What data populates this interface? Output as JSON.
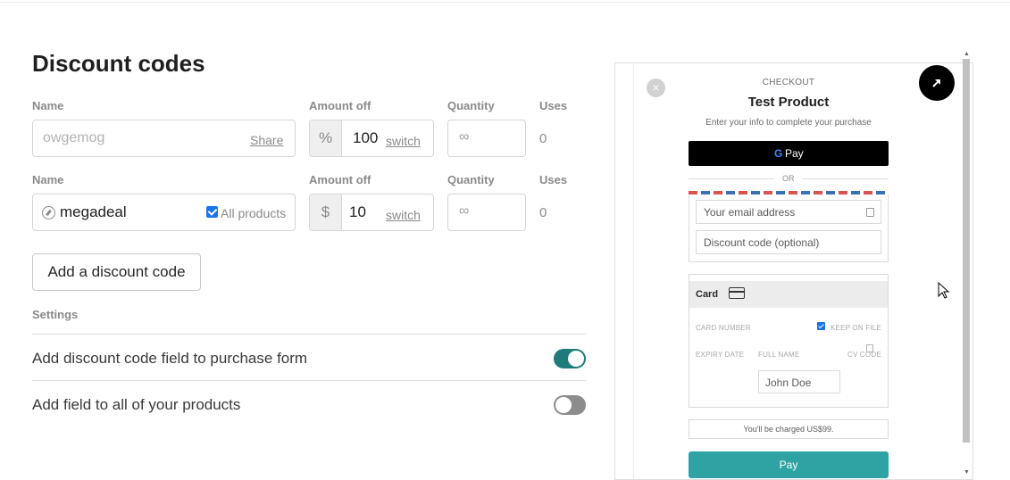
{
  "page": {
    "title": "Discount codes"
  },
  "columns": {
    "name": "Name",
    "amount_off": "Amount off",
    "quantity": "Quantity",
    "uses": "Uses"
  },
  "codes": [
    {
      "name_placeholder": "owgemog",
      "share_label": "Share",
      "unit": "%",
      "amount": "100",
      "switch_label": "switch",
      "quantity": "∞",
      "uses": "0"
    },
    {
      "name": "megadeal",
      "icon": "compass-icon",
      "all_products_label": "All products",
      "all_products_checked": true,
      "unit": "$",
      "amount": "10",
      "switch_label": "switch",
      "quantity": "∞",
      "uses": "0"
    }
  ],
  "add_button_label": "Add a discount code",
  "settings": {
    "label": "Settings",
    "items": [
      {
        "label": "Add discount code field to purchase form",
        "enabled": true
      },
      {
        "label": "Add field to all of your products",
        "enabled": false
      }
    ]
  },
  "preview": {
    "close_symbol": "×",
    "checkout_label": "CHECKOUT",
    "product_title": "Test Product",
    "subtitle": "Enter your info to complete your purchase",
    "gpay_g": "G",
    "gpay_label": "Pay",
    "or_label": "OR",
    "email_placeholder": "Your email address",
    "discount_placeholder": "Discount code (optional)",
    "card_title": "Card",
    "card_number_label": "CARD NUMBER",
    "keep_on_file_label": "KEEP ON FILE",
    "keep_on_file_checked": true,
    "expiry_label": "EXPIRY DATE",
    "full_name_label": "FULL NAME",
    "cv_label": "CV CODE",
    "name_placeholder": "John Doe",
    "charged_text": "You'll be charged US$99.",
    "pay_label": "Pay"
  },
  "colors": {
    "toggle_on": "#1f7a7a",
    "toggle_off": "#8c8c8c",
    "pay_button": "#2fa3a3",
    "checkbox": "#1a73e8"
  }
}
